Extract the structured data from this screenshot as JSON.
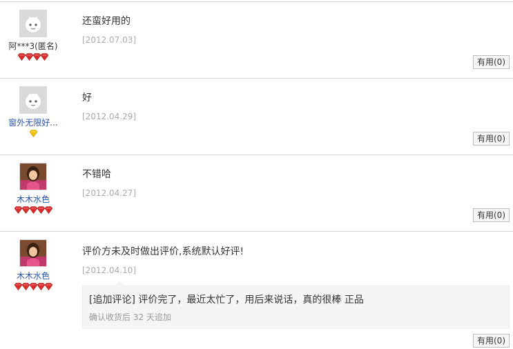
{
  "reviews": [
    {
      "user": "阿***3(匿名)",
      "user_style": "anon",
      "avatar": "default-face",
      "level_icons": "red-diamond x4",
      "text": "还蛮好用的",
      "date": "[2012.07.03]",
      "useful": "有用(0)"
    },
    {
      "user": "窗外无限好...",
      "user_style": "link",
      "avatar": "default-face",
      "level_icons": "yellow-heart x1",
      "text": "好",
      "date": "[2012.04.29]",
      "useful": "有用(0)"
    },
    {
      "user": "木木水色",
      "user_style": "link",
      "avatar": "photo",
      "level_icons": "red-diamond x5",
      "text": "不错哈",
      "date": "[2012.04.27]",
      "useful": "有用(0)"
    },
    {
      "user": "木木水色",
      "user_style": "link",
      "avatar": "photo",
      "level_icons": "red-diamond x5",
      "text": "评价方未及时做出评价,系统默认好评!",
      "date": "[2012.04.10]",
      "append": {
        "text": "[追加评论] 评价完了，最近太忙了，用后来说话，真的很棒 正品",
        "note": "确认收货后 32 天追加"
      },
      "useful": "有用(0)"
    }
  ],
  "colors": {
    "username_link": "#2953a6",
    "date": "#aaaaaa",
    "divider": "#d8d8d8",
    "append_bg": "#f5f5f5",
    "gem_red": "#d92b2b",
    "gem_yellow": "#f2c200"
  }
}
